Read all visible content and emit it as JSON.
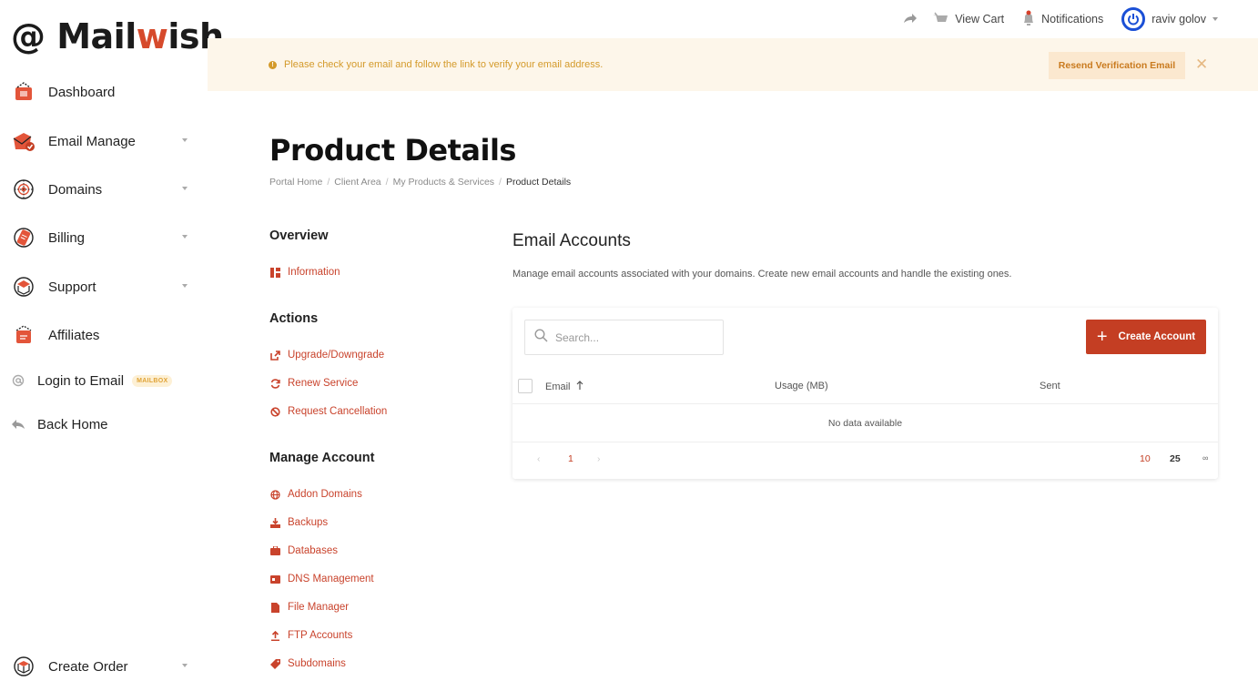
{
  "brand": {
    "logo_prefix": "@ Mail",
    "logo_mark": "w",
    "logo_suffix": "ish"
  },
  "sidebar": {
    "items": [
      {
        "label": "Dashboard",
        "icon": "dashboard-icon"
      },
      {
        "label": "Email Manage",
        "icon": "email-manage-icon",
        "has_submenu": true
      },
      {
        "label": "Domains",
        "icon": "domains-icon",
        "has_submenu": true
      },
      {
        "label": "Billing",
        "icon": "billing-icon",
        "has_submenu": true
      },
      {
        "label": "Support",
        "icon": "support-icon",
        "has_submenu": true
      },
      {
        "label": "Affiliates",
        "icon": "affiliates-icon"
      },
      {
        "label": "Login to Email",
        "icon": "at-icon",
        "badge": "MAILBOX"
      },
      {
        "label": "Back Home",
        "icon": "back-arrow-icon"
      }
    ],
    "bottom": {
      "label": "Create Order",
      "icon": "box-icon",
      "has_submenu": true
    }
  },
  "topbar": {
    "view_cart": "View Cart",
    "notifications": "Notifications",
    "user": "raviv golov"
  },
  "alert": {
    "message": "Please check your email and follow the link to verify your email address.",
    "action": "Resend Verification Email"
  },
  "page": {
    "title": "Product Details",
    "breadcrumb": [
      "Portal Home",
      "Client Area",
      "My Products & Services",
      "Product Details"
    ]
  },
  "panel": {
    "overview_heading": "Overview",
    "overview_links": [
      "Information"
    ],
    "actions_heading": "Actions",
    "action_links": [
      "Upgrade/Downgrade",
      "Renew Service",
      "Request Cancellation"
    ],
    "manage_heading": "Manage Account",
    "manage_links": [
      "Addon Domains",
      "Backups",
      "Databases",
      "DNS Management",
      "File Manager",
      "FTP Accounts",
      "Subdomains"
    ]
  },
  "email_accounts": {
    "title": "Email Accounts",
    "description": "Manage email accounts associated with your domains. Create new email accounts and handle the existing ones.",
    "search_placeholder": "Search...",
    "create_label": "Create Account",
    "columns": [
      "Email",
      "Usage (MB)",
      "Sent"
    ],
    "empty_text": "No data available",
    "pagination": {
      "current_page": "1",
      "page_sizes": [
        "10",
        "25",
        "∞"
      ],
      "active_size": "10"
    }
  },
  "colors": {
    "accent": "#c43e23",
    "alert_bg": "#fdf6ea",
    "alert_text": "#d49a2a",
    "user_ring": "#1a4fd6"
  }
}
